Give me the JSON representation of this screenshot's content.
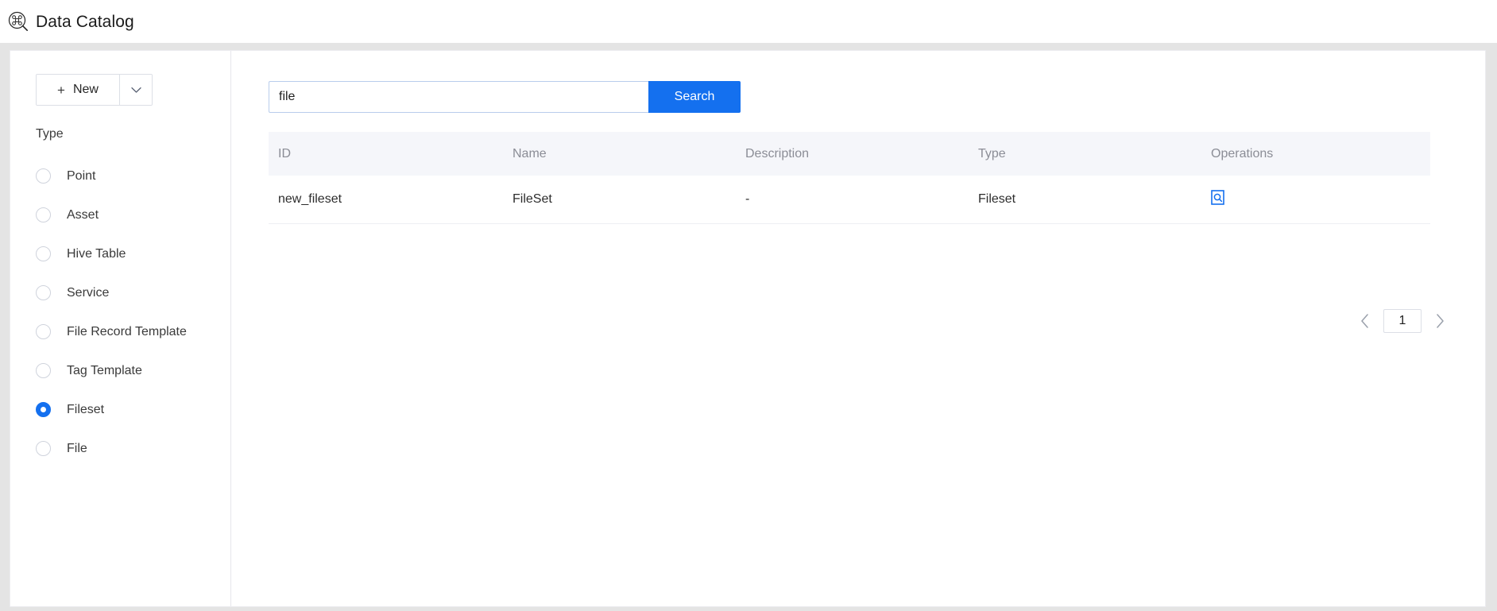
{
  "header": {
    "title": "Data Catalog",
    "logo_icon": "catalog-search-graph-icon"
  },
  "sidebar": {
    "new_button": {
      "label": "New",
      "plus_icon": "plus-icon",
      "dropdown_icon": "chevron-down-icon"
    },
    "filter_title": "Type",
    "type_options": [
      {
        "label": "Point",
        "selected": false
      },
      {
        "label": "Asset",
        "selected": false
      },
      {
        "label": "Hive Table",
        "selected": false
      },
      {
        "label": "Service",
        "selected": false
      },
      {
        "label": "File Record Template",
        "selected": false
      },
      {
        "label": "Tag Template",
        "selected": false
      },
      {
        "label": "Fileset",
        "selected": true
      },
      {
        "label": "File",
        "selected": false
      }
    ]
  },
  "search": {
    "value": "file",
    "placeholder": "",
    "button_label": "Search"
  },
  "table": {
    "columns": [
      "ID",
      "Name",
      "Description",
      "Type",
      "Operations"
    ],
    "rows": [
      {
        "id": "new_fileset",
        "name": "FileSet",
        "description": "-",
        "type": "Fileset",
        "operation_icon": "view-detail-magnifier-icon"
      }
    ]
  },
  "pagination": {
    "prev_icon": "chevron-left-icon",
    "next_icon": "chevron-right-icon",
    "current_page": "1"
  },
  "colors": {
    "accent": "#1470ef",
    "page_background": "#e4e4e4",
    "card_background": "#ffffff",
    "table_header_background": "#f5f6fa",
    "muted_text": "#8b8d96"
  }
}
